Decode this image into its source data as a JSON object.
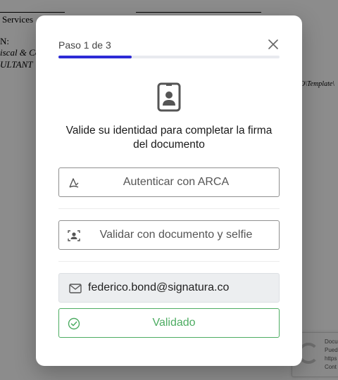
{
  "background_document": {
    "fragment_1": "Services",
    "fragment_2": "N:",
    "fragment_3": "iscal & Co",
    "fragment_4": "ULTANT",
    "fragment_5": "O\\Template\\",
    "recaptcha_lines": [
      "Docu",
      "Pued",
      "https",
      "Cont"
    ]
  },
  "modal": {
    "step_label": "Paso 1 de 3",
    "progress": 0.33,
    "heading": "Valide su identidad para completar la firma del documento",
    "options": [
      {
        "label": "Autenticar con ARCA",
        "icon": "arca-icon"
      },
      {
        "label": "Validar con documento y selfie",
        "icon": "id-selfie-icon"
      }
    ],
    "email": "federico.bond@signatura.co",
    "validated_label": "Validado"
  },
  "colors": {
    "accent": "#2d2bd6",
    "success": "#4dac62",
    "track": "#e8eaef",
    "email_bg": "#eceef0"
  }
}
